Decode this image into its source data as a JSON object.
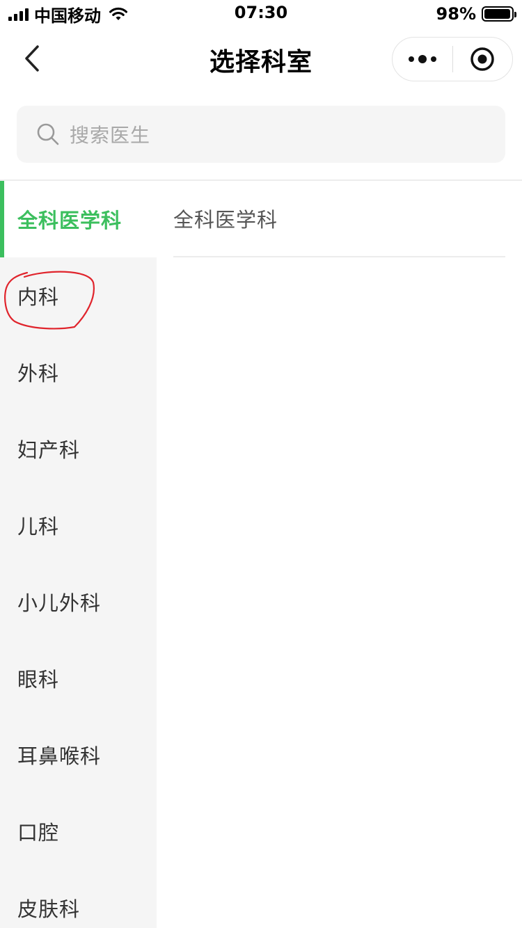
{
  "status_bar": {
    "carrier": "中国移动",
    "time": "07:30",
    "battery": "98%",
    "battery_level": 0.98,
    "icons": [
      "signal-icon",
      "wifi-icon",
      "battery-icon"
    ]
  },
  "nav": {
    "title": "选择科室",
    "icons": [
      "back-chevron-icon",
      "more-dots-icon",
      "target-icon"
    ]
  },
  "search": {
    "placeholder": "搜索医生",
    "icon": "search-icon"
  },
  "sidebar": {
    "active_index": 0,
    "items": [
      {
        "label": "全科医学科"
      },
      {
        "label": "内科"
      },
      {
        "label": "外科"
      },
      {
        "label": "妇产科"
      },
      {
        "label": "儿科"
      },
      {
        "label": "小儿外科"
      },
      {
        "label": "眼科"
      },
      {
        "label": "耳鼻喉科"
      },
      {
        "label": "口腔"
      },
      {
        "label": "皮肤科"
      }
    ]
  },
  "content": {
    "items": [
      {
        "label": "全科医学科"
      }
    ]
  },
  "colors": {
    "accent": "#3cbf5e",
    "sidebar_bg": "#f5f5f5",
    "annotation": "#e0242c"
  }
}
